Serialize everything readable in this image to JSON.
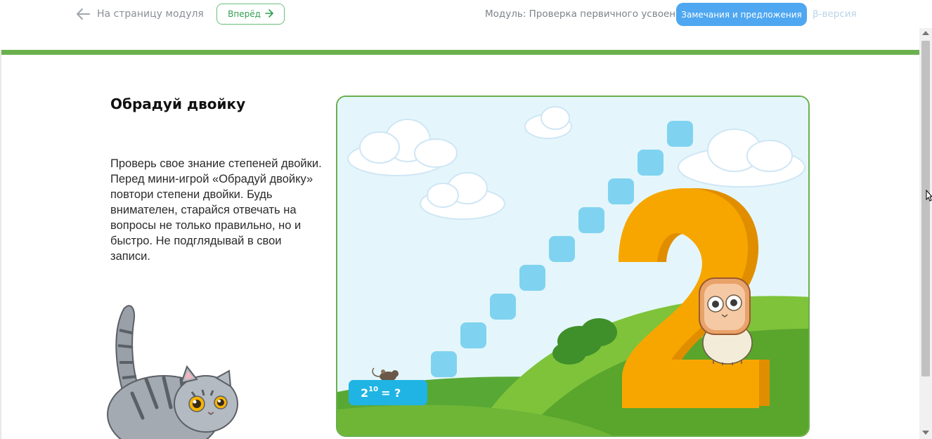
{
  "header": {
    "back_label": "На страницу модуля",
    "forward_label": "Вперёд",
    "module_label": "Модуль: Проверка первичного усвоения",
    "feedback_label": "Замечания и предложения",
    "beta_label": "β-версия"
  },
  "lesson": {
    "title": "Обрадуй двойку",
    "description": "Проверь свое знание степеней двойки. Перед мини-игрой «Обрадуй двойку» повтори степени двойки. Будь внимателен, старайся отвечать на вопросы не только правильно, но и быстро. Не подглядывай в свои записи."
  },
  "game": {
    "question_base": "2",
    "question_exponent": "10",
    "question_rest": "= ?",
    "big_digit": "2",
    "steps_count": 9
  },
  "colors": {
    "accent_green": "#6ab04c",
    "button_blue": "#4ea7f0",
    "step_blue": "#7fd3f0",
    "digit_orange": "#f7a600"
  }
}
